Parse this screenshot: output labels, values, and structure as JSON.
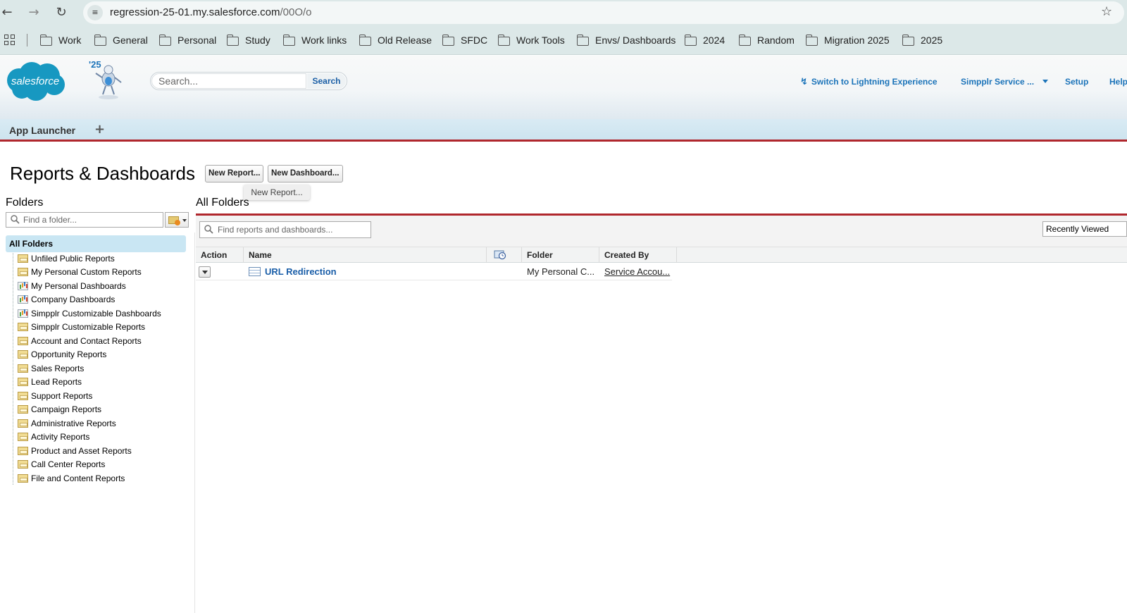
{
  "browser": {
    "url_host": "regression-25-01.my.salesforce.com",
    "url_path": "/00O/o",
    "bookmarks": [
      "Work",
      "General",
      "Personal",
      "Study",
      "Work links",
      "Old Release",
      "SFDC",
      "Work Tools",
      "Envs/ Dashboards",
      "2024",
      "Random",
      "Migration 2025",
      "2025"
    ]
  },
  "header": {
    "logo_text": "salesforce",
    "release_badge": "'25",
    "search_placeholder": "Search...",
    "search_button": "Search",
    "lightning_link": "Switch to Lightning Experience",
    "user_menu": "Simpplr Service ...",
    "setup_link": "Setup",
    "help_link": "Help"
  },
  "app_bar": {
    "app_launcher": "App Launcher",
    "plus": "+"
  },
  "page": {
    "title": "Reports & Dashboards",
    "new_report_button": "New Report...",
    "new_dashboard_button": "New Dashboard...",
    "tooltip": "New Report..."
  },
  "folders": {
    "title": "Folders",
    "find_placeholder": "Find a folder...",
    "all_folders": "All Folders",
    "items": [
      {
        "label": "Unfiled Public Reports",
        "icon": "folder-icon"
      },
      {
        "label": "My Personal Custom Reports",
        "icon": "folder-icon"
      },
      {
        "label": "My Personal Dashboards",
        "icon": "dashboard-folder-icon"
      },
      {
        "label": "Company Dashboards",
        "icon": "dashboard-folder-icon"
      },
      {
        "label": "Simpplr Customizable Dashboards",
        "icon": "dashboard-folder-icon"
      },
      {
        "label": "Simpplr Customizable Reports",
        "icon": "folder-icon"
      },
      {
        "label": "Account and Contact Reports",
        "icon": "folder-icon"
      },
      {
        "label": "Opportunity Reports",
        "icon": "folder-icon"
      },
      {
        "label": "Sales Reports",
        "icon": "folder-icon"
      },
      {
        "label": "Lead Reports",
        "icon": "folder-icon"
      },
      {
        "label": "Support Reports",
        "icon": "folder-icon"
      },
      {
        "label": "Campaign Reports",
        "icon": "folder-icon"
      },
      {
        "label": "Administrative Reports",
        "icon": "folder-icon"
      },
      {
        "label": "Activity Reports",
        "icon": "folder-icon"
      },
      {
        "label": "Product and Asset Reports",
        "icon": "folder-icon"
      },
      {
        "label": "Call Center Reports",
        "icon": "folder-icon"
      },
      {
        "label": "File and Content Reports",
        "icon": "folder-icon"
      }
    ]
  },
  "main": {
    "title": "All Folders",
    "find_placeholder": "Find reports and dashboards...",
    "view_select": "Recently Viewed",
    "columns": [
      "Action",
      "Name",
      "Folder",
      "Created By"
    ],
    "rows": [
      {
        "name": "URL Redirection",
        "folder": "My Personal C...",
        "created_by": "Service Accou..."
      }
    ]
  },
  "colors": {
    "accent_red": "#b0272d",
    "link_blue": "#1a5ea8",
    "selection": "#c9e6f3",
    "salesforce_blue": "#1798c1"
  }
}
